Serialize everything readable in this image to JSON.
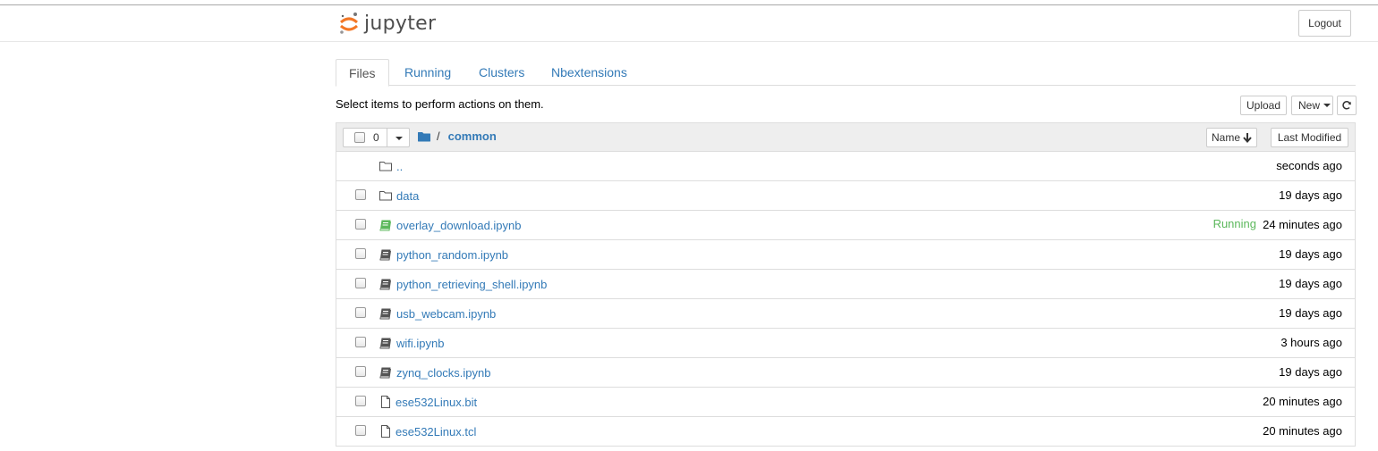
{
  "header": {
    "logo_text": "jupyter",
    "logout_label": "Logout"
  },
  "tabs": [
    {
      "label": "Files"
    },
    {
      "label": "Running"
    },
    {
      "label": "Clusters"
    },
    {
      "label": "Nbextensions"
    }
  ],
  "toolbar": {
    "hint": "Select items to perform actions on them.",
    "upload_label": "Upload",
    "new_label": "New",
    "refresh_icon": "refresh-icon"
  },
  "list_header": {
    "selected_count": "0",
    "breadcrumb_separator": "/",
    "breadcrumb_current": "common",
    "sort_name_label": "Name",
    "sort_modified_label": "Last Modified"
  },
  "items": [
    {
      "name": "..",
      "kind": "folder",
      "modified": "seconds ago",
      "status": ""
    },
    {
      "name": "data",
      "kind": "folder",
      "modified": "19 days ago",
      "status": ""
    },
    {
      "name": "overlay_download.ipynb",
      "kind": "notebook-running",
      "modified": "24 minutes ago",
      "status": "Running"
    },
    {
      "name": "python_random.ipynb",
      "kind": "notebook",
      "modified": "19 days ago",
      "status": ""
    },
    {
      "name": "python_retrieving_shell.ipynb",
      "kind": "notebook",
      "modified": "19 days ago",
      "status": ""
    },
    {
      "name": "usb_webcam.ipynb",
      "kind": "notebook",
      "modified": "19 days ago",
      "status": ""
    },
    {
      "name": "wifi.ipynb",
      "kind": "notebook",
      "modified": "3 hours ago",
      "status": ""
    },
    {
      "name": "zynq_clocks.ipynb",
      "kind": "notebook",
      "modified": "19 days ago",
      "status": ""
    },
    {
      "name": "ese532Linux.bit",
      "kind": "file",
      "modified": "20 minutes ago",
      "status": ""
    },
    {
      "name": "ese532Linux.tcl",
      "kind": "file",
      "modified": "20 minutes ago",
      "status": ""
    }
  ],
  "colors": {
    "link": "#337ab7",
    "running": "#5cb85c",
    "logo_orange": "#f37726"
  }
}
